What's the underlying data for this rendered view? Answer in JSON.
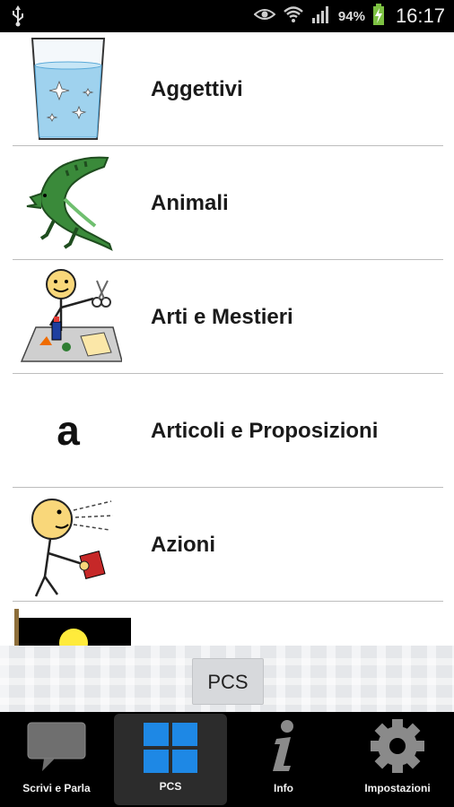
{
  "status_bar": {
    "battery": "94%",
    "time": "16:17",
    "icons": [
      "usb-icon",
      "eye-icon",
      "wifi-icon",
      "signal-icon",
      "battery-charging-icon"
    ]
  },
  "categories": [
    {
      "label": "Aggettivi",
      "icon": "glass-of-water-icon"
    },
    {
      "label": "Animali",
      "icon": "crocodile-icon"
    },
    {
      "label": "Arti e Mestieri",
      "icon": "arts-and-crafts-icon"
    },
    {
      "label": "Articoli e Proposizioni",
      "icon": "letter-a-icon",
      "icon_text": "a"
    },
    {
      "label": "Azioni",
      "icon": "person-speaking-icon"
    },
    {
      "label": "",
      "icon": "flag-icon"
    }
  ],
  "pcs_button": {
    "label": "PCS"
  },
  "bottom_nav": [
    {
      "label": "Scrivi e Parla",
      "icon": "speech-bubble-icon",
      "active": false
    },
    {
      "label": "PCS",
      "icon": "grid-icon",
      "active": true
    },
    {
      "label": "Info",
      "icon": "info-icon",
      "active": false
    },
    {
      "label": "Impostazioni",
      "icon": "gear-icon",
      "active": false
    }
  ],
  "colors": {
    "status_bar_bg": "#000000",
    "list_bg": "#ffffff",
    "divider": "#bdbdbd",
    "nav_bg": "#000000",
    "nav_active_bg": "#2c2c2c",
    "grid_icon_blue": "#1e88e5",
    "battery_green": "#7cc142"
  }
}
